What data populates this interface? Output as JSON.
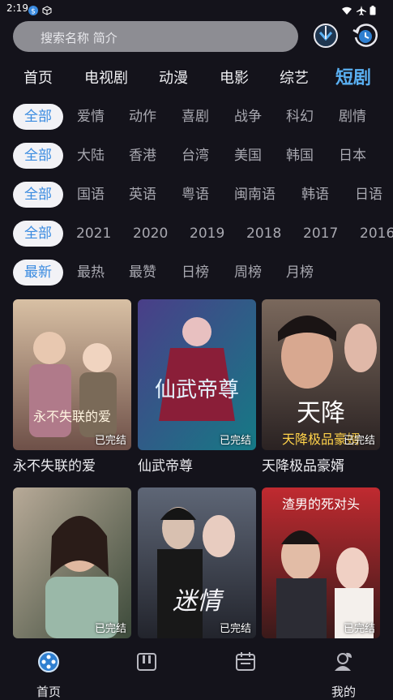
{
  "status": {
    "time": "2:19"
  },
  "search": {
    "placeholder": "搜索名称 简介"
  },
  "header_icons": [
    "download-icon",
    "history-icon"
  ],
  "tabs": [
    {
      "label": "首页"
    },
    {
      "label": "电视剧"
    },
    {
      "label": "动漫"
    },
    {
      "label": "电影"
    },
    {
      "label": "综艺"
    },
    {
      "label": "短剧",
      "active": true
    }
  ],
  "filters": {
    "genre": {
      "selected": "全部",
      "options": [
        "爱情",
        "动作",
        "喜剧",
        "战争",
        "科幻",
        "剧情"
      ]
    },
    "region": {
      "selected": "全部",
      "options": [
        "大陆",
        "香港",
        "台湾",
        "美国",
        "韩国",
        "日本"
      ]
    },
    "language": {
      "selected": "全部",
      "options": [
        "国语",
        "英语",
        "粤语",
        "闽南语",
        "韩语",
        "日语"
      ]
    },
    "year": {
      "selected": "全部",
      "options": [
        "2021",
        "2020",
        "2019",
        "2018",
        "2017",
        "2016"
      ]
    },
    "sort": {
      "selected": "最新",
      "options": [
        "最热",
        "最赞",
        "日榜",
        "周榜",
        "月榜"
      ]
    }
  },
  "posters": [
    {
      "title": "永不失联的爱",
      "badge": "已完结",
      "art_text": "永不失联的爱",
      "colors": [
        "#c9a98b",
        "#7a5a52"
      ]
    },
    {
      "title": "仙武帝尊",
      "badge": "已完结",
      "art_text": "仙武帝尊",
      "colors": [
        "#3b3f78",
        "#1a7b8c"
      ]
    },
    {
      "title": "天降极品豪婿",
      "badge": "已完结",
      "art_text": "天降",
      "art_subtext": "天降极品豪婿",
      "colors": [
        "#6b5a52",
        "#2a2424"
      ]
    },
    {
      "title": "",
      "badge": "已完结",
      "colors": [
        "#9a8c7e",
        "#3e4a3c"
      ]
    },
    {
      "title": "",
      "badge": "已完结",
      "art_text": "迷情",
      "colors": [
        "#2c2f3a",
        "#5a6272"
      ]
    },
    {
      "title": "",
      "badge": "已完结",
      "art_text": "渣男的死对头",
      "colors": [
        "#b3262b",
        "#2b1818"
      ]
    }
  ],
  "bottom_nav": [
    {
      "label": "首页",
      "icon": "film-reel-icon"
    },
    {
      "label": "",
      "icon": "piano-icon"
    },
    {
      "label": "",
      "icon": "calendar-icon"
    },
    {
      "label": "我的",
      "icon": "user-icon"
    }
  ],
  "colors": {
    "accent": "#5ab0f2",
    "background": "#14131b",
    "chip_selected_bg": "#f2f2f6"
  }
}
